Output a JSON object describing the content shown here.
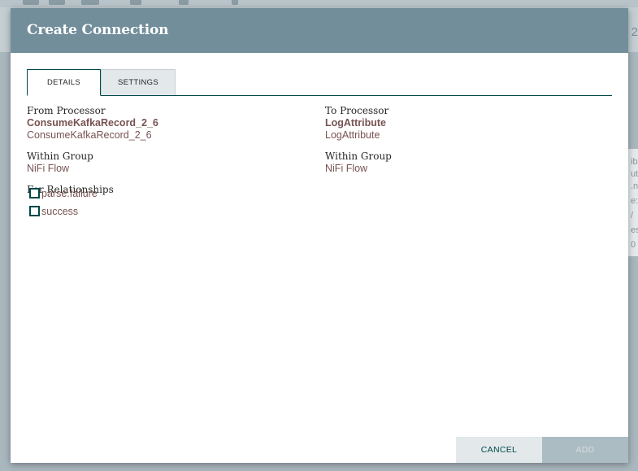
{
  "background": {
    "edge_text": "2"
  },
  "dialog": {
    "title": "Create Connection",
    "tabs": [
      {
        "label": "DETAILS",
        "active": true
      },
      {
        "label": "SETTINGS",
        "active": false
      }
    ],
    "from": {
      "heading": "From Processor",
      "name": "ConsumeKafkaRecord_2_6",
      "type": "ConsumeKafkaRecord_2_6",
      "group_heading": "Within Group",
      "group": "NiFi Flow"
    },
    "to": {
      "heading": "To Processor",
      "name": "LogAttribute",
      "type": "LogAttribute",
      "group_heading": "Within Group",
      "group": "NiFi Flow"
    },
    "relationships": {
      "heading": "For Relationships",
      "items": [
        {
          "label": "parse.failure",
          "checked": false
        },
        {
          "label": "success",
          "checked": false
        }
      ]
    },
    "buttons": {
      "cancel": "CANCEL",
      "add": "ADD"
    }
  },
  "colors": {
    "header": "#728e9b",
    "accent": "#004849",
    "value_text": "#775351",
    "button_light": "#e3e8eb",
    "button_disabled": "#acbcc3"
  }
}
